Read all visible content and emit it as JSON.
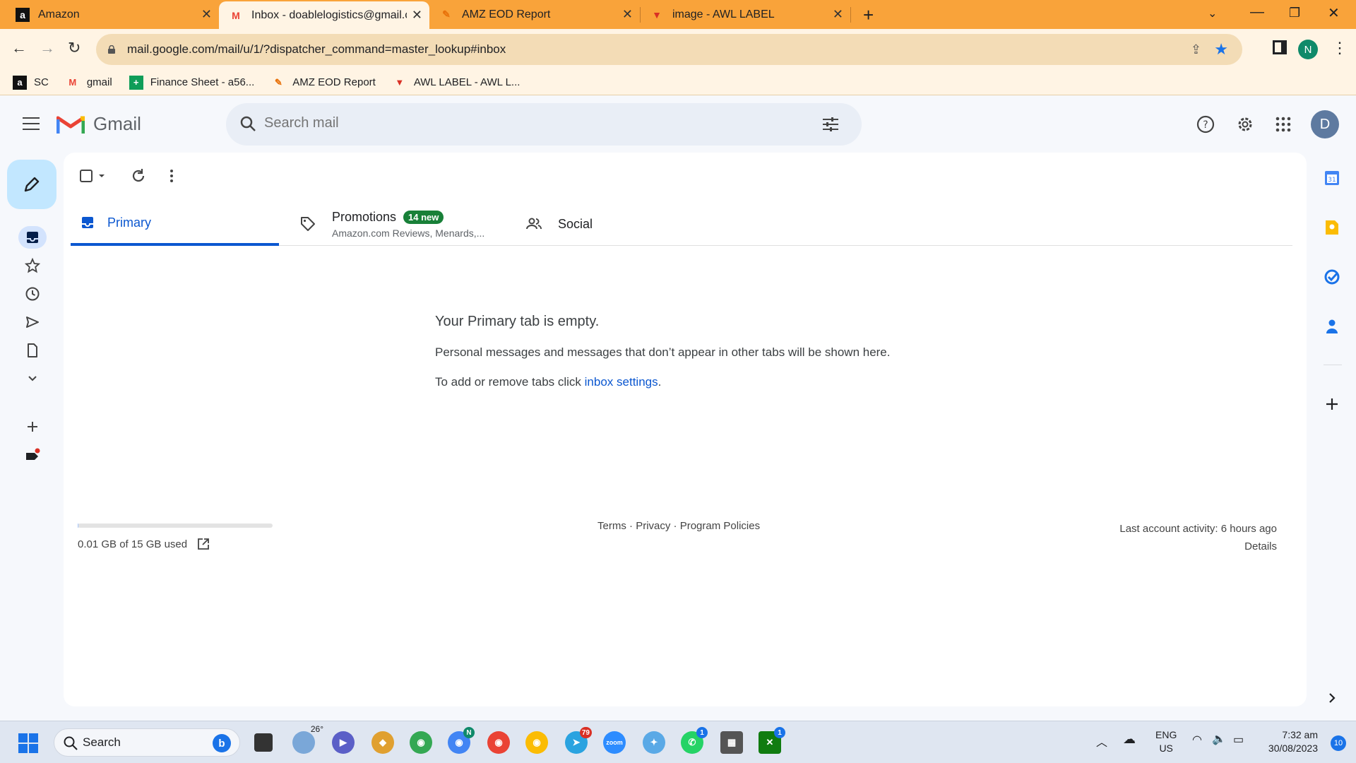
{
  "browser": {
    "tabs": [
      {
        "title": "Amazon",
        "favicon": "a"
      },
      {
        "title": "Inbox - doablelogistics@gmail.co",
        "favicon": "M"
      },
      {
        "title": "AMZ EOD Report",
        "favicon": "✎"
      },
      {
        "title": "image - AWL LABEL",
        "favicon": "▼"
      }
    ],
    "url": "mail.google.com/mail/u/1/?dispatcher_command=master_lookup#inbox",
    "profile_initial": "N",
    "bookmarks": [
      {
        "label": "SC",
        "icon": "a"
      },
      {
        "label": "gmail",
        "icon": "M"
      },
      {
        "label": "Finance Sheet - a56...",
        "icon": "+"
      },
      {
        "label": "AMZ EOD Report",
        "icon": "✎"
      },
      {
        "label": "AWL LABEL - AWL L...",
        "icon": "▼"
      }
    ]
  },
  "gmail": {
    "logo_text": "Gmail",
    "search_placeholder": "Search mail",
    "account_initial": "D",
    "tabs": {
      "primary": "Primary",
      "promotions": "Promotions",
      "promotions_badge": "14 new",
      "promotions_snippet": "Amazon.com Reviews, Menards,...",
      "social": "Social"
    },
    "empty": {
      "heading": "Your Primary tab is empty.",
      "line1": "Personal messages and messages that don’t appear in other tabs will be shown here.",
      "line2_prefix": "To add or remove tabs click ",
      "line2_link": "inbox settings",
      "line2_suffix": "."
    },
    "footer": {
      "storage_text": "0.01 GB of 15 GB used",
      "storage_fraction": 0.001,
      "terms": "Terms",
      "sep": "·",
      "privacy": "Privacy",
      "program_policies": "Program Policies",
      "last_activity": "Last account activity: 6 hours ago",
      "details": "Details"
    }
  },
  "taskbar": {
    "search_label": "Search",
    "weather_temp": "26°",
    "chrome_badge_letter": "N",
    "telegram_badge": "79",
    "whatsapp_badge": "1",
    "xbox_badge": "1",
    "language": "ENG",
    "region": "US",
    "time": "7:32 am",
    "date": "30/08/2023",
    "notification_count": "10"
  },
  "colors": {
    "tabstrip": "#f9a33a",
    "toolbar": "#fff4e4",
    "gmail_blue": "#0b57d0",
    "badge_green": "#188038"
  }
}
